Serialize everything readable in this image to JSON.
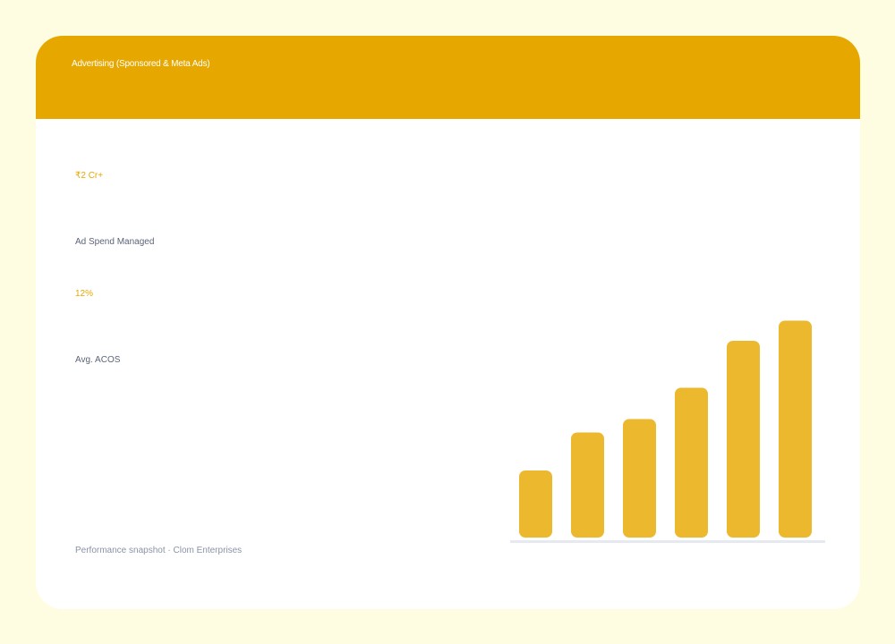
{
  "header": {
    "title": "Advertising (Sponsored & Meta Ads)"
  },
  "stats": [
    {
      "value": "₹2 Cr+",
      "label": "Ad Spend Managed"
    },
    {
      "value": "12%",
      "label": "Avg. ACOS"
    }
  ],
  "footer": {
    "text": "Performance snapshot · Clom Enterprises"
  },
  "colors": {
    "page_background": "#fffde1",
    "header": "#e6a800",
    "accent_text": "#e6a800",
    "bar": "#ecb92e",
    "baseline": "#e6e9f0"
  },
  "chart_data": {
    "type": "bar",
    "categories": [
      "",
      "",
      "",
      "",
      "",
      ""
    ],
    "values": [
      30,
      47,
      53,
      67,
      88,
      97
    ],
    "title": "",
    "xlabel": "",
    "ylabel": "",
    "ylim": [
      0,
      100
    ],
    "grid": false
  }
}
